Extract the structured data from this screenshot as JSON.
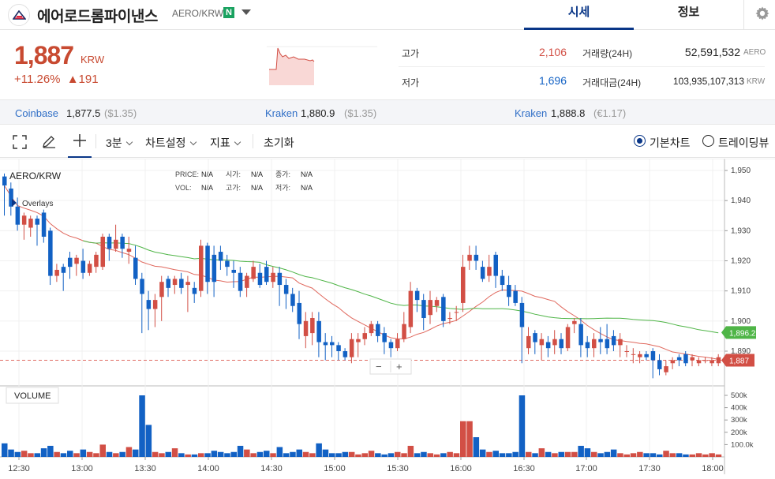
{
  "header": {
    "coin_name": "에어로드롬파이낸스",
    "pair": "AERO/KRW",
    "badge": "N",
    "tabs": [
      "시세",
      "정보"
    ]
  },
  "summary": {
    "price": "1,887",
    "currency": "KRW",
    "change_pct": "+11.26%",
    "change_amt": "▲191",
    "high_label": "고가",
    "high": "2,106",
    "low_label": "저가",
    "low": "1,696",
    "volume_label": "거래량(24H)",
    "volume": "52,591,532",
    "volume_unit": "AERO",
    "amount_label": "거래대금(24H)",
    "amount": "103,935,107,313",
    "amount_unit": "KRW"
  },
  "exchanges": [
    {
      "name": "Coinbase",
      "price": "1,877.5",
      "usd": "($1.35)"
    },
    {
      "name": "Kraken",
      "price": "1,880.9",
      "usd": "($1.35)"
    },
    {
      "name": "Kraken",
      "price": "1,888.8",
      "usd": "(€1.17)"
    }
  ],
  "toolbar": {
    "interval": "3분",
    "chart_settings": "차트설정",
    "indicators": "지표",
    "reset": "초기화",
    "basic_chart": "기본차트",
    "tradingview": "트레이딩뷰"
  },
  "chart_info": {
    "symbol": "AERO/KRW",
    "overlays": "Overlays",
    "price_lbl": "PRICE:",
    "price_val": "N/A",
    "open_lbl": "시가:",
    "open_val": "N/A",
    "close_lbl": "종가:",
    "close_val": "N/A",
    "vol_lbl": "VOL:",
    "vol_val": "N/A",
    "high_lbl": "고가:",
    "high_val": "N/A",
    "low_lbl": "저가:",
    "low_val": "N/A",
    "volume_title": "VOLUME",
    "zoom_out": "−",
    "zoom_in": "+",
    "ma_tag": "1,896.2",
    "last_tag": "1,887",
    "y_ticks": [
      "1,950",
      "1,940",
      "1,930",
      "1,920",
      "1,910",
      "1,900",
      "1,890"
    ],
    "v_ticks": [
      "500k",
      "400k",
      "300k",
      "200k",
      "100.0k"
    ],
    "x_ticks": [
      "12:30",
      "13:00",
      "13:30",
      "14:00",
      "14:30",
      "15:00",
      "15:30",
      "16:00",
      "16:30",
      "17:00",
      "17:30",
      "18:00"
    ]
  },
  "colors": {
    "up": "#d24f45",
    "down": "#1261c4",
    "accent": "#093687",
    "ma_short": "#e0685d",
    "ma_long": "#4fb547"
  },
  "chart_data": {
    "type": "candlestick",
    "ylim": [
      1884,
      1953
    ],
    "candles": [
      [
        1948,
        1945,
        1949,
        1935
      ],
      [
        1944,
        1938,
        1946,
        1935
      ],
      [
        1938,
        1932,
        1941,
        1930
      ],
      [
        1932,
        1935,
        1936,
        1927
      ],
      [
        1931,
        1934,
        1935,
        1928
      ],
      [
        1934,
        1932,
        1935,
        1925
      ],
      [
        1936,
        1928,
        1937,
        1926
      ],
      [
        1930,
        1915,
        1931,
        1912
      ],
      [
        1915,
        1917,
        1919,
        1913
      ],
      [
        1918,
        1916,
        1919,
        1910
      ],
      [
        1921,
        1918,
        1923,
        1914
      ],
      [
        1919,
        1921,
        1922,
        1915
      ],
      [
        1920,
        1916,
        1924,
        1914
      ],
      [
        1916,
        1919,
        1920,
        1915
      ],
      [
        1918,
        1922,
        1923,
        1916
      ],
      [
        1918,
        1928,
        1929,
        1917
      ],
      [
        1928,
        1924,
        1929,
        1920
      ],
      [
        1924,
        1927,
        1932,
        1923
      ],
      [
        1928,
        1924,
        1929,
        1921
      ],
      [
        1923,
        1924,
        1928,
        1919
      ],
      [
        1921,
        1914,
        1925,
        1912
      ],
      [
        1914,
        1909,
        1916,
        1896
      ],
      [
        1907,
        1904,
        1910,
        1897
      ],
      [
        1904,
        1907,
        1909,
        1898
      ],
      [
        1908,
        1913,
        1915,
        1900
      ],
      [
        1914,
        1911,
        1915,
        1908
      ],
      [
        1912,
        1914,
        1915,
        1909
      ],
      [
        1914,
        1911,
        1916,
        1909
      ],
      [
        1912,
        1913,
        1915,
        1903
      ],
      [
        1911,
        1909,
        1913,
        1906
      ],
      [
        1910,
        1925,
        1927,
        1908
      ],
      [
        1925,
        1913,
        1926,
        1909
      ],
      [
        1922,
        1913,
        1925,
        1908
      ],
      [
        1923,
        1920,
        1925,
        1917
      ],
      [
        1920,
        1918,
        1922,
        1915
      ],
      [
        1917,
        1916,
        1920,
        1911
      ],
      [
        1916,
        1910,
        1918,
        1908
      ],
      [
        1911,
        1915,
        1916,
        1908
      ],
      [
        1914,
        1918,
        1920,
        1913
      ],
      [
        1916,
        1912,
        1919,
        1911
      ],
      [
        1918,
        1913,
        1920,
        1912
      ],
      [
        1913,
        1916,
        1918,
        1911
      ],
      [
        1916,
        1912,
        1918,
        1905
      ],
      [
        1912,
        1909,
        1914,
        1904
      ],
      [
        1909,
        1905,
        1911,
        1903
      ],
      [
        1906,
        1899,
        1910,
        1894
      ],
      [
        1895,
        1900,
        1903,
        1891
      ],
      [
        1896,
        1901,
        1903,
        1892
      ],
      [
        1900,
        1893,
        1903,
        1888
      ],
      [
        1893,
        1892,
        1896,
        1887
      ],
      [
        1893,
        1892,
        1895,
        1888
      ],
      [
        1892,
        1890,
        1893,
        1887
      ],
      [
        1890,
        1888,
        1891,
        1887
      ],
      [
        1888,
        1894,
        1896,
        1886
      ],
      [
        1893,
        1894,
        1896,
        1888
      ],
      [
        1894,
        1896,
        1898,
        1892
      ],
      [
        1896,
        1899,
        1900,
        1895
      ],
      [
        1899,
        1895,
        1900,
        1893
      ],
      [
        1896,
        1893,
        1898,
        1889
      ],
      [
        1893,
        1891,
        1894,
        1888
      ],
      [
        1891,
        1894,
        1896,
        1890
      ],
      [
        1894,
        1899,
        1903,
        1893
      ],
      [
        1898,
        1910,
        1913,
        1896
      ],
      [
        1910,
        1907,
        1911,
        1903
      ],
      [
        1907,
        1901,
        1909,
        1897
      ],
      [
        1902,
        1907,
        1910,
        1899
      ],
      [
        1905,
        1907,
        1908,
        1903
      ],
      [
        1908,
        1900,
        1909,
        1898
      ],
      [
        1901,
        1901,
        1903,
        1899
      ],
      [
        1903,
        1903,
        1905,
        1900
      ],
      [
        1906,
        1918,
        1922,
        1903
      ],
      [
        1920,
        1922,
        1925,
        1917
      ],
      [
        1922,
        1920,
        1925,
        1917
      ],
      [
        1918,
        1914,
        1920,
        1913
      ],
      [
        1915,
        1918,
        1922,
        1913
      ],
      [
        1922,
        1915,
        1923,
        1911
      ],
      [
        1915,
        1912,
        1917,
        1910
      ],
      [
        1912,
        1908,
        1915,
        1905
      ],
      [
        1910,
        1906,
        1912,
        1905
      ],
      [
        1906,
        1898,
        1908,
        1886
      ],
      [
        1891,
        1895,
        1898,
        1889
      ],
      [
        1896,
        1893,
        1897,
        1889
      ],
      [
        1892,
        1894,
        1896,
        1887
      ],
      [
        1893,
        1891,
        1895,
        1888
      ],
      [
        1892,
        1894,
        1897,
        1889
      ],
      [
        1894,
        1891,
        1896,
        1889
      ],
      [
        1891,
        1898,
        1899,
        1890
      ],
      [
        1899,
        1900,
        1901,
        1896
      ],
      [
        1899,
        1892,
        1901,
        1888
      ],
      [
        1893,
        1891,
        1895,
        1888
      ],
      [
        1891,
        1894,
        1896,
        1888
      ],
      [
        1894,
        1893,
        1898,
        1889
      ],
      [
        1894,
        1891,
        1899,
        1889
      ],
      [
        1895,
        1892,
        1897,
        1890
      ],
      [
        1892,
        1894,
        1896,
        1888
      ],
      [
        1890,
        1890,
        1892,
        1888
      ],
      [
        1889,
        1889,
        1891,
        1886
      ],
      [
        1888,
        1889,
        1890,
        1886
      ],
      [
        1889,
        1888,
        1890,
        1887
      ],
      [
        1890,
        1887,
        1891,
        1881
      ],
      [
        1887,
        1884,
        1889,
        1882
      ],
      [
        1883,
        1885,
        1887,
        1882
      ],
      [
        1886,
        1887,
        1888,
        1884
      ],
      [
        1888,
        1887,
        1889,
        1885
      ],
      [
        1889,
        1886,
        1890,
        1885
      ],
      [
        1887,
        1888,
        1889,
        1885
      ],
      [
        1886,
        1887,
        1888,
        1885
      ],
      [
        1887,
        1887,
        1888,
        1886
      ],
      [
        1886,
        1887,
        1888,
        1885
      ],
      [
        1886,
        1888,
        1889,
        1885
      ]
    ],
    "volume": [
      110,
      60,
      40,
      50,
      30,
      30,
      70,
      90,
      40,
      30,
      50,
      30,
      60,
      40,
      30,
      100,
      40,
      30,
      40,
      80,
      60,
      500,
      260,
      40,
      30,
      40,
      70,
      30,
      20,
      20,
      30,
      30,
      50,
      40,
      30,
      40,
      90,
      60,
      30,
      40,
      50,
      30,
      80,
      30,
      40,
      60,
      40,
      30,
      110,
      60,
      30,
      30,
      40,
      40,
      20,
      30,
      50,
      30,
      20,
      30,
      40,
      30,
      90,
      30,
      40,
      30,
      20,
      30,
      40,
      30,
      290,
      290,
      160,
      60,
      40,
      50,
      30,
      30,
      40,
      500,
      40,
      30,
      70,
      40,
      30,
      40,
      40,
      40,
      90,
      70,
      40,
      30,
      40,
      60,
      30,
      20,
      30,
      40,
      30,
      30,
      20,
      50,
      30,
      30,
      20,
      20,
      30,
      20,
      30,
      20
    ],
    "x_ticks": [
      "12:30",
      "13:00",
      "13:30",
      "14:00",
      "14:30",
      "15:00",
      "15:30",
      "16:00",
      "16:30",
      "17:00",
      "17:30",
      "18:00"
    ]
  }
}
